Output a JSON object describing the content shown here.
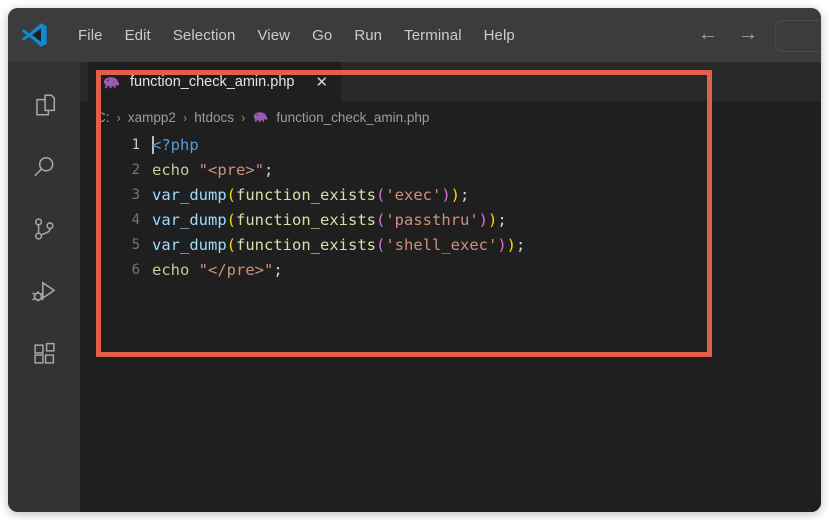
{
  "window": {
    "app_name": "Visual Studio Code",
    "logo_icon": "vscode-logo-icon"
  },
  "menubar": {
    "items": [
      {
        "label": "File"
      },
      {
        "label": "Edit"
      },
      {
        "label": "Selection"
      },
      {
        "label": "View"
      },
      {
        "label": "Go"
      },
      {
        "label": "Run"
      },
      {
        "label": "Terminal"
      },
      {
        "label": "Help"
      }
    ],
    "back_arrow": "←",
    "forward_arrow": "→",
    "command_center_value": ""
  },
  "activity_bar": {
    "items": [
      {
        "name": "explorer-icon",
        "label": "Explorer"
      },
      {
        "name": "search-icon",
        "label": "Search"
      },
      {
        "name": "source-control-icon",
        "label": "Source Control"
      },
      {
        "name": "run-and-debug-icon",
        "label": "Run and Debug"
      },
      {
        "name": "extensions-icon",
        "label": "Extensions"
      }
    ]
  },
  "editor": {
    "tab": {
      "icon": "php-elephant-icon",
      "label": "function_check_amin.php",
      "close_glyph": "✕"
    },
    "breadcrumb": {
      "separator": "›",
      "items": [
        "C:",
        "xampp2",
        "htdocs",
        "function_check_amin.php"
      ],
      "file_icon": "php-elephant-icon"
    },
    "active_line": 1,
    "lines": [
      {
        "number": "1",
        "text": "<?php"
      },
      {
        "number": "2",
        "text": "echo \"<pre>\";"
      },
      {
        "number": "3",
        "text": "var_dump(function_exists('exec'));"
      },
      {
        "number": "4",
        "text": "var_dump(function_exists('passthru'));"
      },
      {
        "number": "5",
        "text": "var_dump(function_exists('shell_exec'));"
      },
      {
        "number": "6",
        "text": "echo \"</pre>\";"
      }
    ],
    "tokens": {
      "php_open": "<?php",
      "echo": "echo",
      "quote": "\"",
      "pre_open": "<pre>",
      "pre_close": "</pre>",
      "semicolon": ";",
      "var_dump": "var_dump",
      "function_exists": "function_exists",
      "paren_open_outer": "(",
      "paren_close_outer": ")",
      "paren_open_inner": "(",
      "paren_close_inner": ")",
      "str_exec": "'exec'",
      "str_passthru": "'passthru'",
      "str_shell_exec": "'shell_exec'"
    }
  },
  "annotation": {
    "highlight_box_color": "#e2604a",
    "shape": "rectangle"
  },
  "colors": {
    "titlebar_bg": "#3c3c3c",
    "activitybar_bg": "#333333",
    "editor_bg": "#1f1f1f",
    "tabbar_bg": "#282828",
    "accent_blue": "#0a84d8",
    "annotation_red": "#e2604a"
  }
}
